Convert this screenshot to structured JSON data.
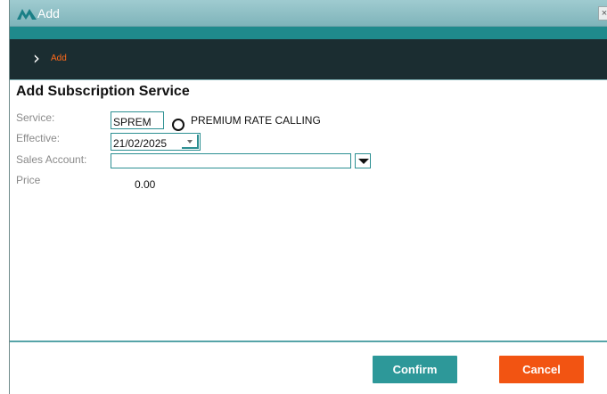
{
  "window": {
    "title": "Add",
    "close_glyph": "×"
  },
  "breadcrumb": {
    "label": "Add"
  },
  "form": {
    "heading": "Add Subscription Service",
    "service": {
      "label": "Service:",
      "code": "SPREM",
      "description": "PREMIUM RATE CALLING"
    },
    "effective": {
      "label": "Effective:",
      "date": "21/02/2025"
    },
    "sales_account": {
      "label": "Sales Account:",
      "value": ""
    },
    "price": {
      "label": "Price",
      "value": "0.00"
    }
  },
  "buttons": {
    "confirm": "Confirm",
    "cancel": "Cancel"
  },
  "colors": {
    "accent": "#2d9899",
    "cancel": "#f25412",
    "nav": "#1b2d31",
    "breadcrumb": "#ff6a1a"
  }
}
